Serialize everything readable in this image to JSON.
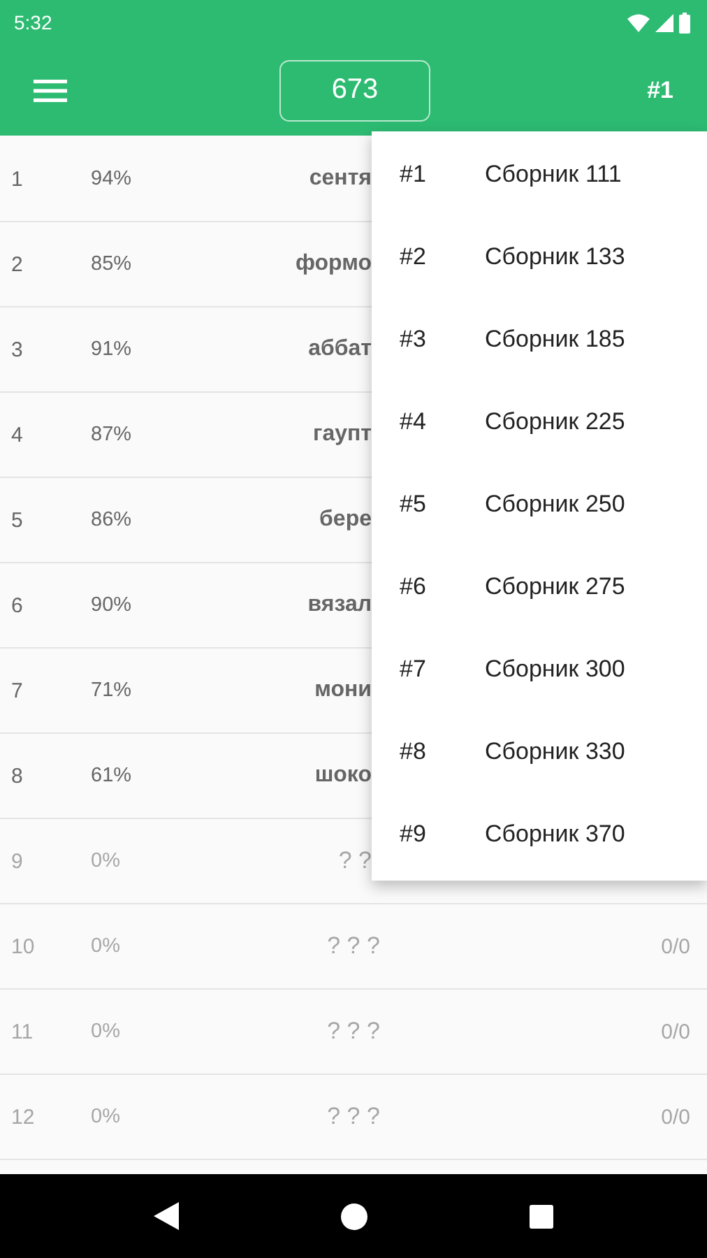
{
  "status_bar": {
    "time": "5:32"
  },
  "app_bar": {
    "counter": "673",
    "collection": "#1"
  },
  "rows": [
    {
      "number": "1",
      "percent": "94%",
      "word": "сентя",
      "covered": true,
      "played": true
    },
    {
      "number": "2",
      "percent": "85%",
      "word": "формо",
      "covered": true,
      "played": true
    },
    {
      "number": "3",
      "percent": "91%",
      "word": "аббат",
      "covered": true,
      "played": true
    },
    {
      "number": "4",
      "percent": "87%",
      "word": "гаупт",
      "covered": true,
      "played": true
    },
    {
      "number": "5",
      "percent": "86%",
      "word": "бере",
      "covered": true,
      "played": true
    },
    {
      "number": "6",
      "percent": "90%",
      "word": "вязал",
      "covered": true,
      "played": true
    },
    {
      "number": "7",
      "percent": "71%",
      "word": "мони",
      "covered": true,
      "played": true
    },
    {
      "number": "8",
      "percent": "61%",
      "word": "шоко",
      "covered": true,
      "played": true
    },
    {
      "number": "9",
      "percent": "0%",
      "word": "? ?",
      "covered": true,
      "played": false
    },
    {
      "number": "10",
      "percent": "0%",
      "word": "? ? ?",
      "score": "0/0",
      "covered": false,
      "played": false
    },
    {
      "number": "11",
      "percent": "0%",
      "word": "? ? ?",
      "score": "0/0",
      "covered": false,
      "played": false
    },
    {
      "number": "12",
      "percent": "0%",
      "word": "? ? ?",
      "score": "0/0",
      "covered": false,
      "played": false
    }
  ],
  "menu": [
    {
      "number": "#1",
      "label": "Сборник 111"
    },
    {
      "number": "#2",
      "label": "Сборник 133"
    },
    {
      "number": "#3",
      "label": "Сборник 185"
    },
    {
      "number": "#4",
      "label": "Сборник 225"
    },
    {
      "number": "#5",
      "label": "Сборник 250"
    },
    {
      "number": "#6",
      "label": "Сборник 275"
    },
    {
      "number": "#7",
      "label": "Сборник 300"
    },
    {
      "number": "#8",
      "label": "Сборник 330"
    },
    {
      "number": "#9",
      "label": "Сборник 370"
    }
  ]
}
